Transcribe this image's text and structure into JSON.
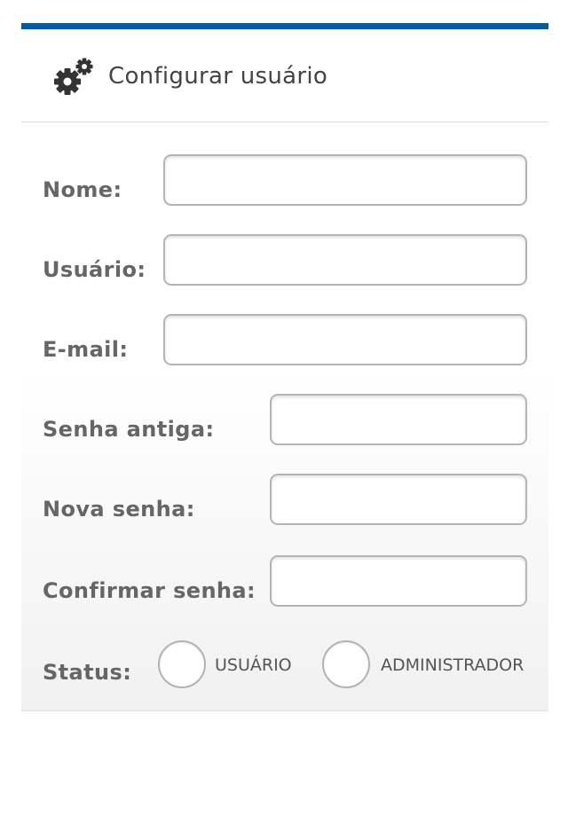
{
  "header": {
    "title": "Configurar usuário",
    "icon": "gears-icon",
    "accent_color": "#0b5b9c"
  },
  "form": {
    "fields": [
      {
        "label": "Nome:",
        "value": "",
        "placeholder": ""
      },
      {
        "label": "Usuário:",
        "value": "",
        "placeholder": ""
      },
      {
        "label": "E-mail:",
        "value": "",
        "placeholder": ""
      },
      {
        "label": "Senha antiga:",
        "value": "",
        "placeholder": ""
      },
      {
        "label": "Nova senha:",
        "value": "",
        "placeholder": ""
      },
      {
        "label": "Confirmar senha:",
        "value": "",
        "placeholder": ""
      }
    ],
    "status": {
      "label": "Status:",
      "options": [
        {
          "label": "USUÁRIO",
          "selected": false
        },
        {
          "label": "ADMINISTRADOR",
          "selected": false
        }
      ]
    }
  }
}
